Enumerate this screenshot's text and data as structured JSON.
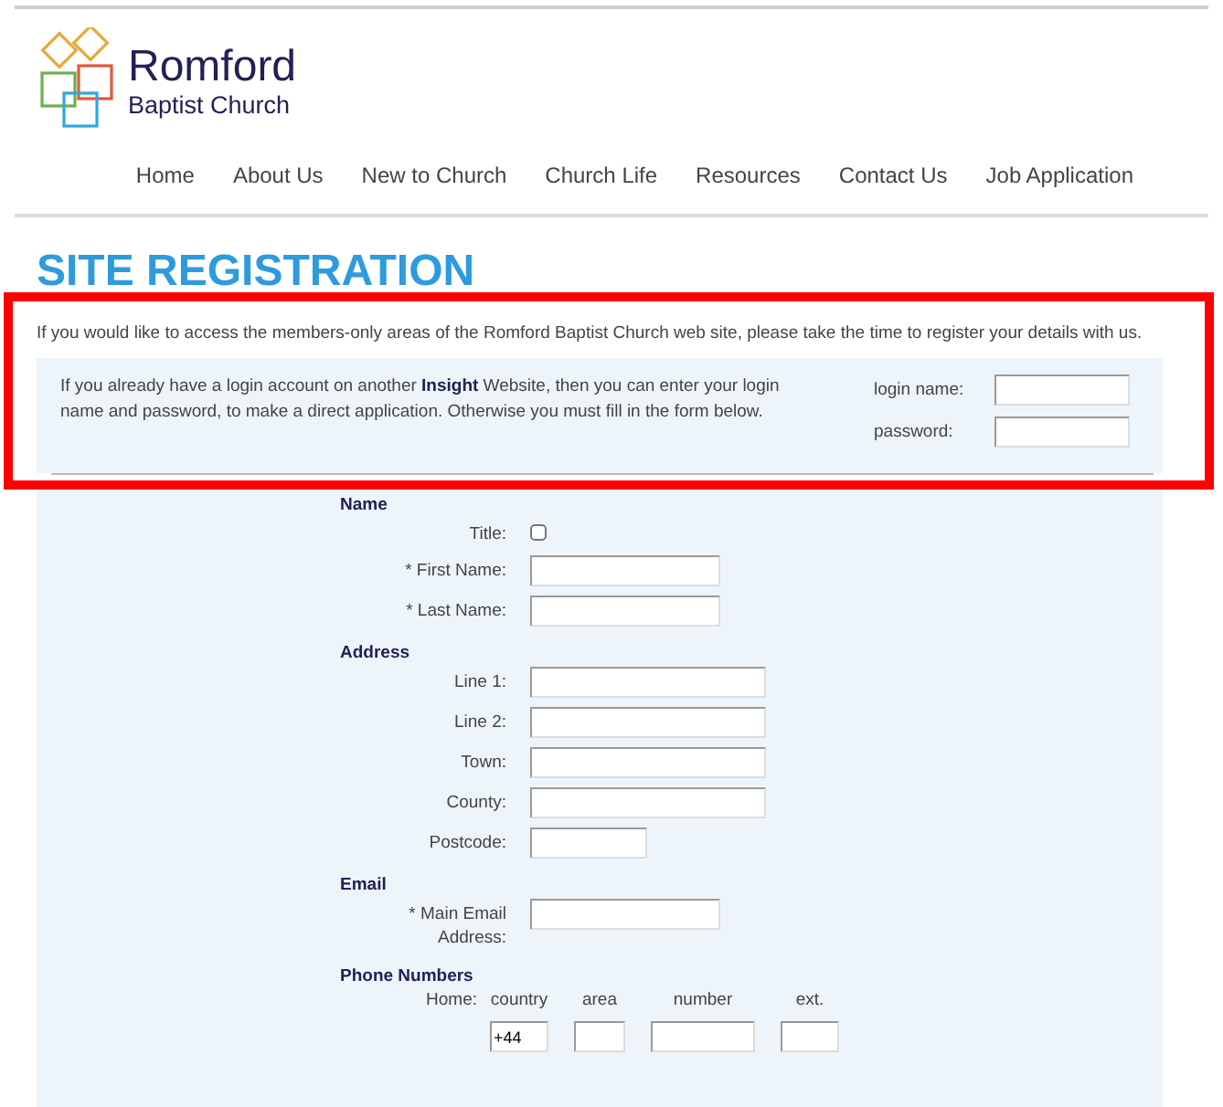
{
  "logo": {
    "name": "Romford",
    "subtitle": "Baptist Church"
  },
  "nav": [
    {
      "label": "Home"
    },
    {
      "label": "About Us"
    },
    {
      "label": "New to Church"
    },
    {
      "label": "Church Life"
    },
    {
      "label": "Resources"
    },
    {
      "label": "Contact Us"
    },
    {
      "label": "Job Application"
    }
  ],
  "title": "SITE REGISTRATION",
  "intro": "If you would like to access the members-only areas of the Romford Baptist Church web site, please take the time to register your details with us.",
  "login": {
    "text": "If you already have a login account on another **Insight** Website, then you can enter your login name and password, to make a direct application. Otherwise you must fill in the form below.",
    "fields": [
      {
        "label": "login name:"
      },
      {
        "label": "password:"
      }
    ]
  },
  "sections": [
    {
      "heading": "Name",
      "fields": [
        {
          "kind": "checkbox",
          "label": "Title:",
          "checked": false
        },
        {
          "kind": "text",
          "label": "* First Name:"
        },
        {
          "kind": "text",
          "label": "* Last Name:"
        }
      ]
    },
    {
      "heading": "Address",
      "fields": [
        {
          "kind": "longtext",
          "label": "Line 1:"
        },
        {
          "kind": "longtext",
          "label": "Line 2:"
        },
        {
          "kind": "longtext",
          "label": "Town:"
        },
        {
          "kind": "longtext",
          "label": "County:"
        },
        {
          "kind": "shorttext",
          "label": "Postcode:"
        }
      ]
    },
    {
      "heading": "Email",
      "fields": [
        {
          "kind": "text",
          "label": "* Main Email Address:"
        }
      ]
    },
    {
      "heading": "Phone Numbers",
      "fields": [
        {
          "kind": "phone",
          "label": "Home:",
          "parts": [
            {
              "label": "country",
              "value": "+44",
              "kind": "narrow"
            },
            {
              "label": "area",
              "kind": "tiny"
            },
            {
              "label": "number",
              "kind": "wide"
            },
            {
              "label": "ext.",
              "kind": "narrow"
            }
          ]
        }
      ]
    }
  ],
  "highlight": {
    "kind": "frame"
  }
}
